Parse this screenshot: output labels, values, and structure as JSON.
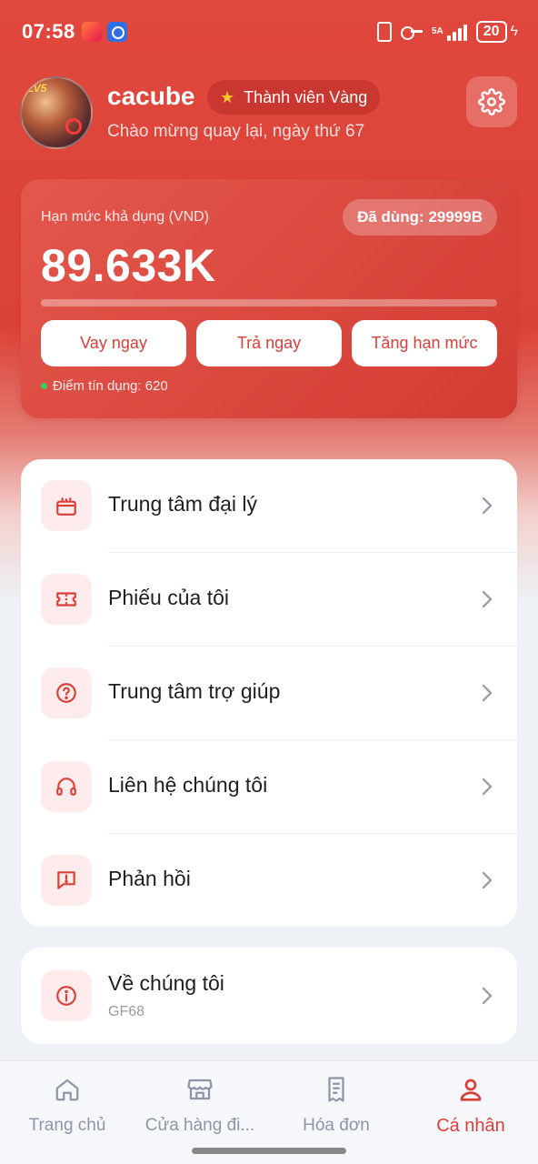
{
  "status_bar": {
    "time": "07:58",
    "network": "5A",
    "battery": "20"
  },
  "profile": {
    "username": "cacube",
    "member_level": "Thành viên Vàng",
    "welcome": "Chào mừng quay lại, ngày thứ 67"
  },
  "credit": {
    "limit_label": "Hạn mức khả dụng (VND)",
    "used_badge": "Đã dùng: 29999B",
    "limit_value": "89.633K",
    "progress_fraction": 0,
    "actions": [
      "Vay ngay",
      "Trả ngay",
      "Tăng hạn mức"
    ],
    "credit_score": "Điểm tín dụng: 620"
  },
  "menu": [
    {
      "label": "Trung tâm đại lý",
      "icon": "gift-icon"
    },
    {
      "label": "Phiếu của tôi",
      "icon": "ticket-icon"
    },
    {
      "label": "Trung tâm trợ giúp",
      "icon": "help-icon"
    },
    {
      "label": "Liên hệ chúng tôi",
      "icon": "headset-icon"
    },
    {
      "label": "Phản hồi",
      "icon": "feedback-icon"
    }
  ],
  "about": {
    "label": "Về chúng tôi",
    "subtitle": "GF68",
    "icon": "info-icon"
  },
  "bottom_nav": [
    {
      "label": "Trang chủ",
      "icon": "home-icon",
      "active": false
    },
    {
      "label": "Cửa hàng đi...",
      "icon": "store-icon",
      "active": false
    },
    {
      "label": "Hóa đơn",
      "icon": "receipt-icon",
      "active": false
    },
    {
      "label": "Cá nhân",
      "icon": "user-icon",
      "active": true
    }
  ],
  "colors": {
    "brand_red": "#d9403a",
    "icon_bg": "#fdeceb",
    "nav_inactive": "#8d95a6",
    "success_dot": "#3ccd62"
  }
}
